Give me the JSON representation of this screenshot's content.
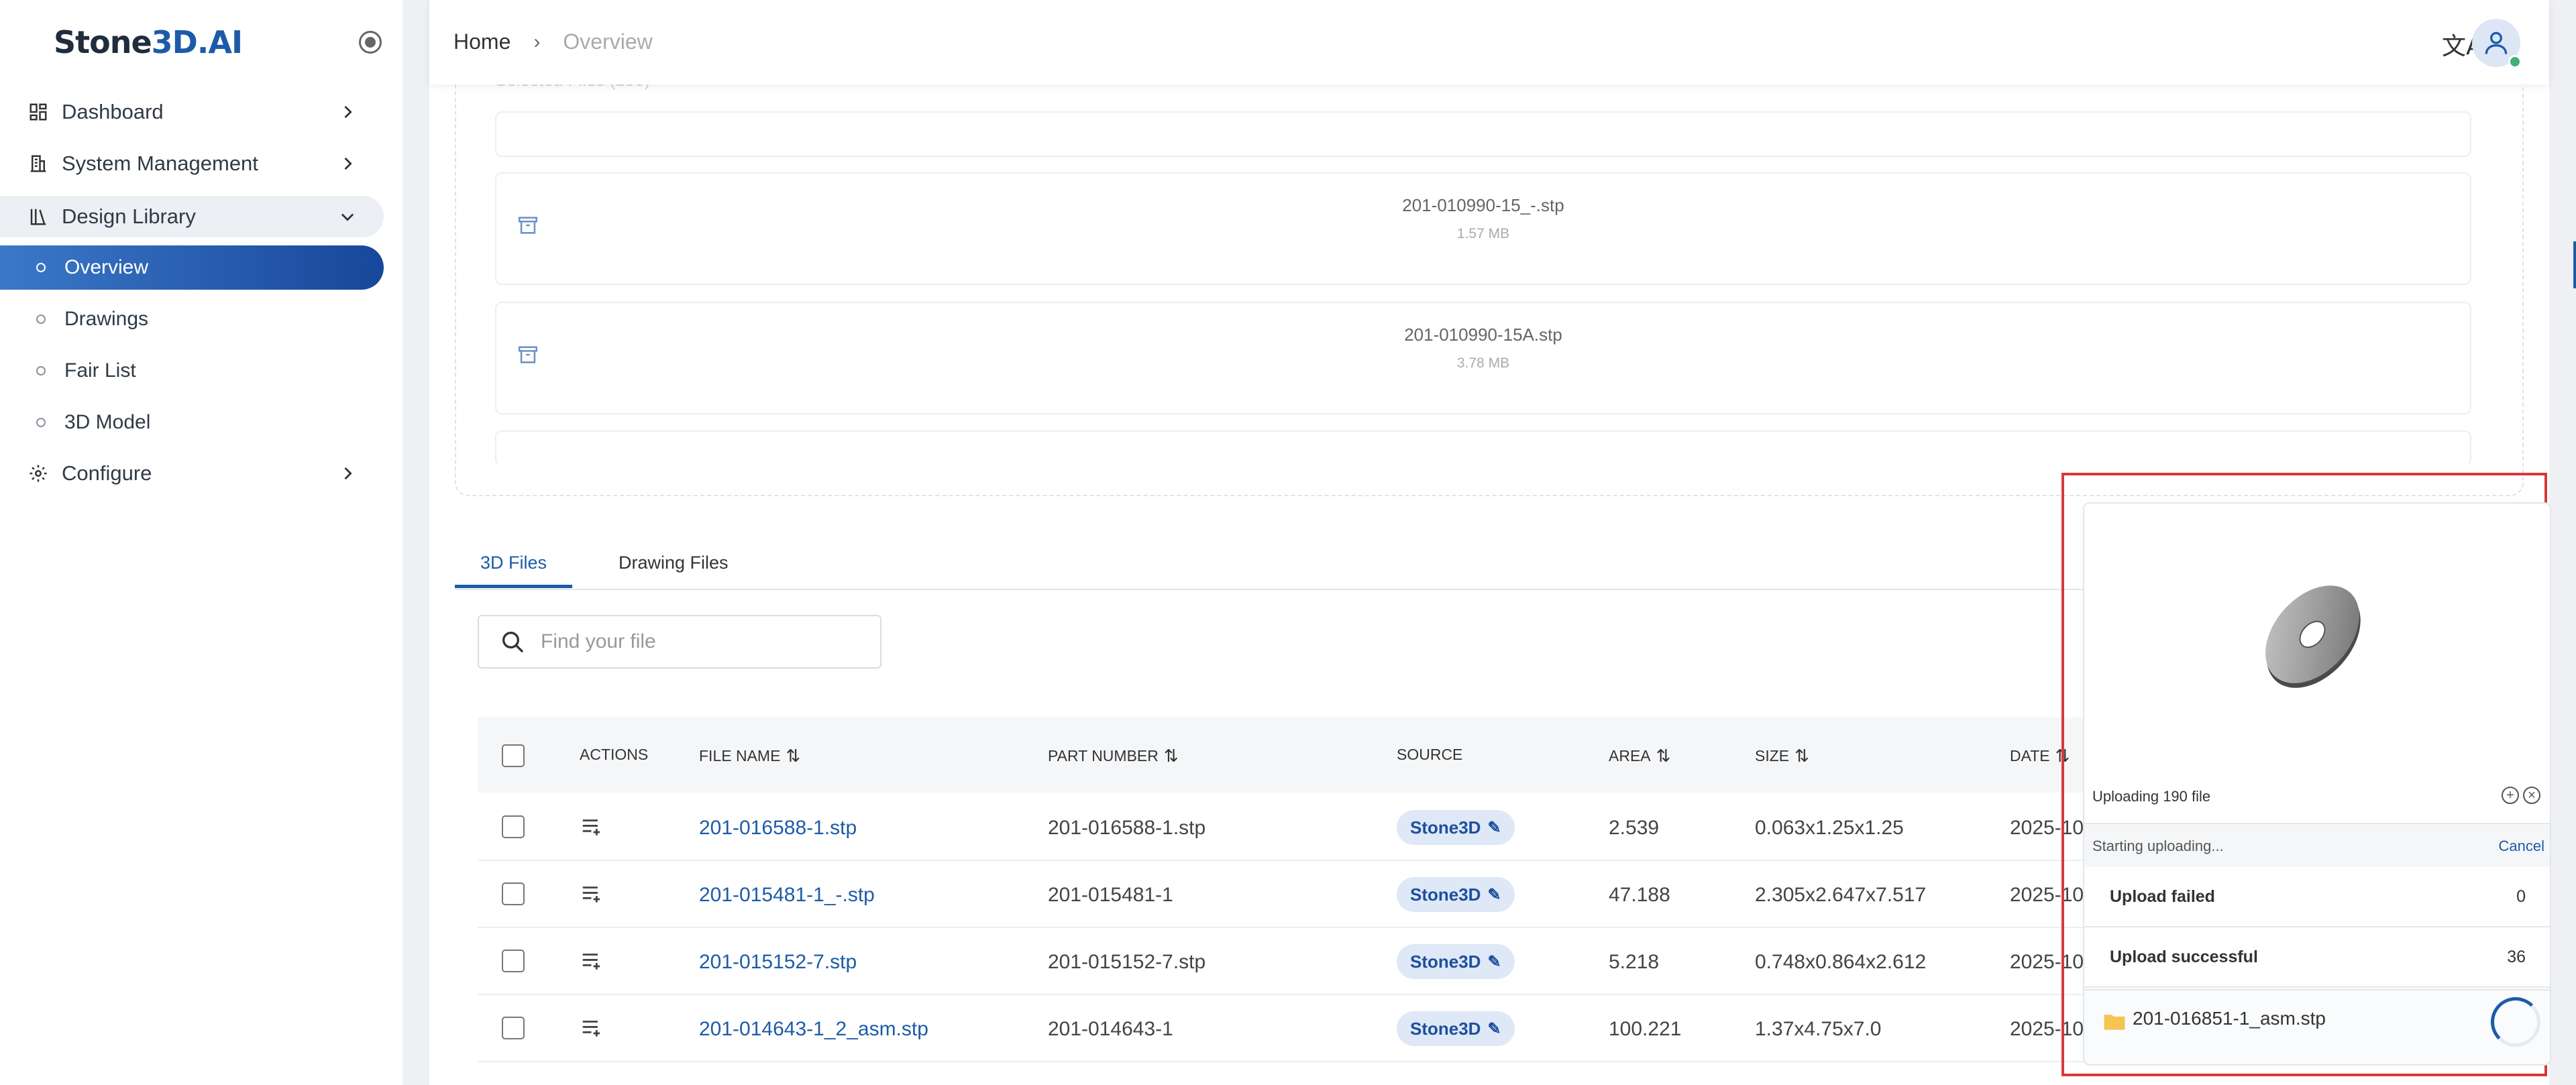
{
  "app": {
    "logo_prefix": "Stone",
    "logo_accent": "3D.AI"
  },
  "sidebar": {
    "items": [
      {
        "label": "Dashboard"
      },
      {
        "label": "System Management"
      },
      {
        "label": "Design Library"
      },
      {
        "label": "Configure"
      }
    ],
    "subitems": [
      {
        "label": "Overview",
        "active": true
      },
      {
        "label": "Drawings"
      },
      {
        "label": "Fair List"
      },
      {
        "label": "3D Model"
      }
    ]
  },
  "header": {
    "breadcrumb": {
      "home": "Home",
      "current": "Overview"
    },
    "translate_glyph": "文A"
  },
  "dropzone": {
    "files": [
      {
        "name": "201-010990-15_-.stp",
        "size": "1.57 MB"
      },
      {
        "name": "201-010990-15A.stp",
        "size": "3.78 MB"
      }
    ]
  },
  "tabs": [
    {
      "label": "3D Files",
      "active": true
    },
    {
      "label": "Drawing Files"
    }
  ],
  "search": {
    "placeholder": "Find your file"
  },
  "table": {
    "columns": {
      "actions": "ACTIONS",
      "file_name": "FILE NAME",
      "part_number": "PART NUMBER",
      "source": "SOURCE",
      "area": "AREA",
      "size": "SIZE",
      "date": "DATE"
    },
    "rows": [
      {
        "file_name": "201-016588-1.stp",
        "part_number": "201-016588-1.stp",
        "source": "Stone3D",
        "area": "2.539",
        "size": "0.063x1.25x1.25",
        "date": "2025-10"
      },
      {
        "file_name": "201-015481-1_-.stp",
        "part_number": "201-015481-1",
        "source": "Stone3D",
        "area": "47.188",
        "size": "2.305x2.647x7.517",
        "date": "2025-10"
      },
      {
        "file_name": "201-015152-7.stp",
        "part_number": "201-015152-7.stp",
        "source": "Stone3D",
        "area": "5.218",
        "size": "0.748x0.864x2.612",
        "date": "2025-10"
      },
      {
        "file_name": "201-014643-1_2_asm.stp",
        "part_number": "201-014643-1",
        "source": "Stone3D",
        "area": "100.221",
        "size": "1.37x4.75x7.0",
        "date": "2025-10"
      }
    ]
  },
  "upload_panel": {
    "title": "Uploading 190 file",
    "status": "Starting uploading...",
    "cancel_label": "Cancel",
    "failed_label": "Upload failed",
    "failed_count": "0",
    "success_label": "Upload successful",
    "success_count": "36",
    "current_file": "201-016851-1_asm.stp"
  },
  "colors": {
    "accent": "#1d5ba9",
    "highlight_border": "#d63a3a",
    "badge_bg": "#dfe8f6",
    "status_online": "#3cb371"
  }
}
